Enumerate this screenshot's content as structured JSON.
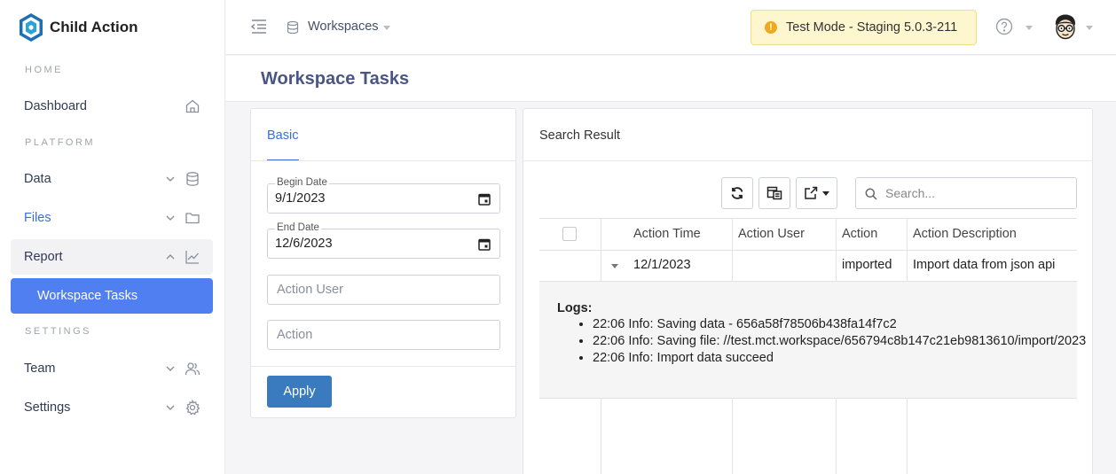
{
  "brand": {
    "name": "Child Action"
  },
  "sidebar": {
    "sections": {
      "home": "HOME",
      "platform": "PLATFORM",
      "settings": "SETTINGS"
    },
    "items": {
      "dashboard": "Dashboard",
      "data": "Data",
      "files": "Files",
      "report": "Report",
      "workspace_tasks": "Workspace Tasks",
      "team": "Team",
      "settings": "Settings"
    }
  },
  "topbar": {
    "workspace_label": "Workspaces",
    "test_mode": "Test Mode - Staging 5.0.3-211",
    "warn_glyph": "!"
  },
  "page": {
    "title": "Workspace Tasks"
  },
  "basic": {
    "tab": "Basic",
    "begin_date_label": "Begin Date",
    "begin_date_value": "9/1/2023",
    "end_date_label": "End Date",
    "end_date_value": "12/6/2023",
    "action_user_placeholder": "Action User",
    "action_placeholder": "Action",
    "apply_label": "Apply"
  },
  "result": {
    "title": "Search Result",
    "search_placeholder": "Search...",
    "columns": {
      "time": "Action Time",
      "user": "Action User",
      "action": "Action",
      "desc": "Action Description"
    },
    "row": {
      "time": "12/1/2023",
      "user": "",
      "action": "imported",
      "desc": "Import data from json api"
    },
    "logs_title": "Logs:",
    "logs": [
      "22:06 Info: Saving data - 656a58f78506b438fa14f7c2",
      "22:06 Info: Saving file: //test.mct.workspace/656794c8b147c21eb9813610/import/2023",
      "22:06 Info: Import data succeed"
    ]
  },
  "colors": {
    "accent": "#4f7ff0",
    "apply": "#3a7abf",
    "link": "#3a6ed6",
    "badge_bg": "#fdf6cf",
    "title": "#4a5585"
  }
}
